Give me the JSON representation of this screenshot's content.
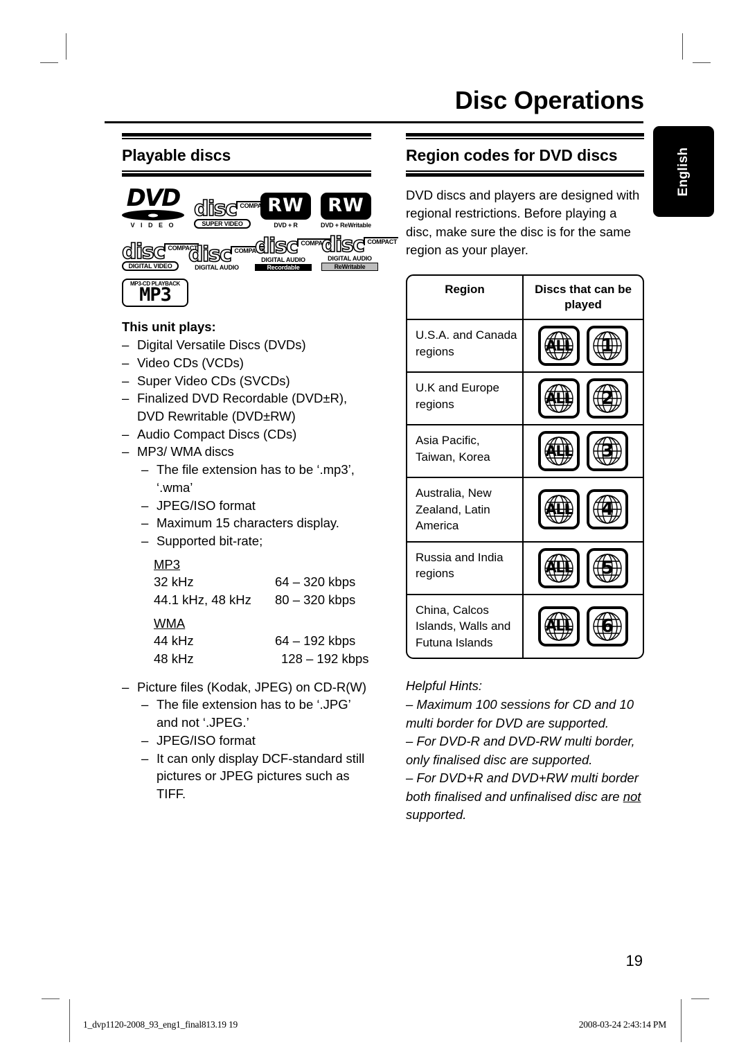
{
  "document": {
    "title": "Disc Operations",
    "language_tab": "English",
    "page_number": "19"
  },
  "footer": {
    "file_reference": "1_dvp1120-2008_93_eng1_final813.19  19",
    "timestamp": "2008-03-24  2:43:14 PM"
  },
  "left_column": {
    "heading": "Playable discs",
    "logos": [
      {
        "name": "dvd-video",
        "main": "DVD",
        "sub": "V I D E O",
        "trademark": "™"
      },
      {
        "name": "compact-disc-super-video",
        "top": "COMPACT",
        "main": "disc",
        "sub": "SUPER VIDEO"
      },
      {
        "name": "dvd-plus-r",
        "main": "RW",
        "sub": "DVD + R"
      },
      {
        "name": "dvd-plus-rewritable",
        "main": "RW",
        "sub": "DVD + ReWritable"
      },
      {
        "name": "compact-disc-digital-video",
        "top": "COMPACT",
        "main": "disc",
        "sub": "DIGITAL VIDEO"
      },
      {
        "name": "compact-disc-digital-audio",
        "top": "COMPACT",
        "main": "disc",
        "sub": "DIGITAL AUDIO"
      },
      {
        "name": "compact-disc-recordable",
        "top": "COMPACT",
        "main": "disc",
        "sub": "DIGITAL AUDIO",
        "sub2": "Recordable"
      },
      {
        "name": "compact-disc-rewritable",
        "top": "COMPACT",
        "main": "disc",
        "sub": "DIGITAL AUDIO",
        "sub2": "ReWritable"
      },
      {
        "name": "mp3-cd-playback",
        "top": "MP3-CD PLAYBACK",
        "main": "MP3"
      }
    ],
    "plays_heading": "This unit plays:",
    "plays_items": [
      {
        "level": 1,
        "text": "Digital Versatile Discs (DVDs)"
      },
      {
        "level": 1,
        "text": "Video CDs (VCDs)"
      },
      {
        "level": 1,
        "text": "Super Video CDs (SVCDs)"
      },
      {
        "level": 1,
        "text": "Finalized DVD Recordable (DVD±R), DVD Rewritable (DVD±RW)"
      },
      {
        "level": 1,
        "text": "Audio Compact Discs (CDs)"
      },
      {
        "level": 1,
        "text": "MP3/ WMA discs"
      },
      {
        "level": 2,
        "text": "The file extension has to be ‘.mp3’, ‘.wma’"
      },
      {
        "level": 2,
        "text": "JPEG/ISO format"
      },
      {
        "level": 2,
        "text": "Maximum 15 characters display."
      },
      {
        "level": 2,
        "text": "Supported bit-rate;"
      }
    ],
    "bitrate_tables": [
      {
        "title": "MP3",
        "rows": [
          {
            "freq": "32 kHz",
            "rate": "64 – 320 kbps"
          },
          {
            "freq": "44.1 kHz, 48 kHz",
            "rate": "80 – 320 kbps"
          }
        ]
      },
      {
        "title": "WMA",
        "rows": [
          {
            "freq": "44 kHz",
            "rate": "64 – 192 kbps"
          },
          {
            "freq": "48 kHz",
            "rate": "128 – 192 kbps"
          }
        ]
      }
    ],
    "picture_items": [
      {
        "level": 1,
        "text": "Picture files (Kodak, JPEG) on CD-R(W)"
      },
      {
        "level": 2,
        "text": "The file extension has to be ‘.JPG’ and not ‘.JPEG.’"
      },
      {
        "level": 2,
        "text": "JPEG/ISO format"
      },
      {
        "level": 2,
        "text": "It can only display DCF-standard still pictures or JPEG pictures such as TIFF."
      }
    ],
    "dash": "–"
  },
  "right_column": {
    "heading": "Region codes for DVD discs",
    "intro": "DVD discs and players are designed with regional restrictions. Before playing a disc, make sure the disc is for the same region as your player.",
    "table": {
      "headers": [
        "Region",
        "Discs that can be played"
      ],
      "rows": [
        {
          "region": "U.S.A. and Canada regions",
          "discs": [
            "ALL",
            "1"
          ]
        },
        {
          "region": "U.K and Europe regions",
          "discs": [
            "ALL",
            "2"
          ]
        },
        {
          "region": "Asia Pacific, Taiwan, Korea",
          "discs": [
            "ALL",
            "3"
          ]
        },
        {
          "region": "Australia, New Zealand, Latin America",
          "discs": [
            "ALL",
            "4"
          ]
        },
        {
          "region": "Russia and India regions",
          "discs": [
            "ALL",
            "5"
          ]
        },
        {
          "region": "China, Calcos Islands, Walls and Futuna Islands",
          "discs": [
            "ALL",
            "6"
          ]
        }
      ]
    },
    "hints": {
      "title": "Helpful Hints:",
      "items": [
        "–  Maximum 100 sessions for CD and 10 multi border for DVD are supported.",
        "–  For DVD-R and DVD-RW multi border, only finalised disc are supported.",
        "–  For DVD+R and DVD+RW multi border both finalised and unfinalised disc are ",
        "supported."
      ],
      "underlined_word": "not"
    }
  }
}
